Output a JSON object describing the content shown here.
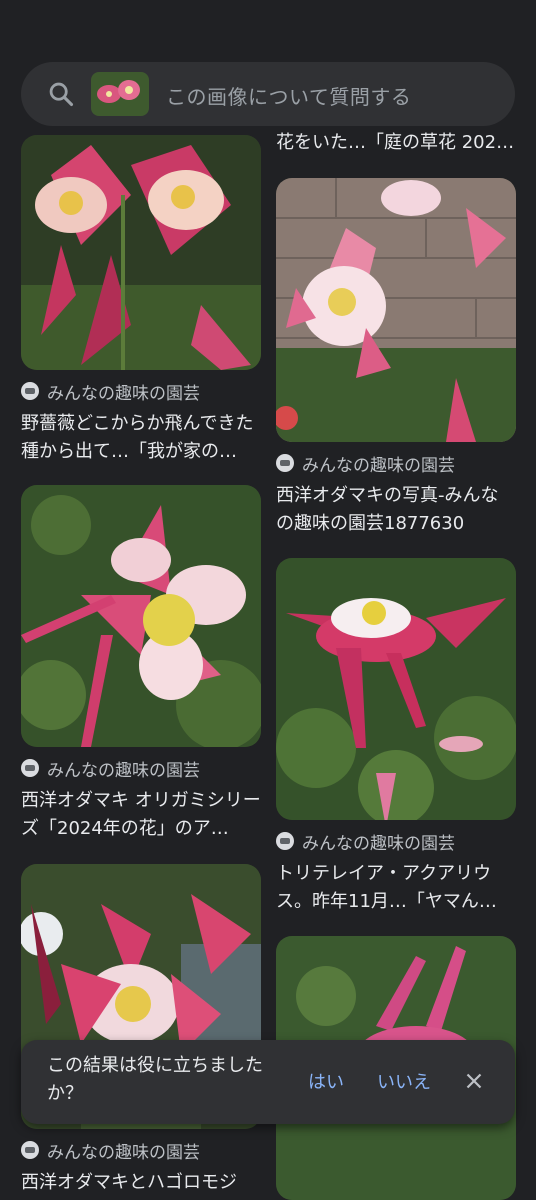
{
  "search": {
    "placeholder": "この画像について質問する"
  },
  "previous_title": "花をいた…「庭の草花 202…",
  "results": {
    "left": [
      {
        "source": "みんなの趣味の園芸",
        "title": "野薔薇どこからか飛んできた種から出て…「我が家の…"
      },
      {
        "source": "みんなの趣味の園芸",
        "title": "西洋オダマキ オリガミシリーズ「2024年の花」のア…"
      },
      {
        "source": "みんなの趣味の園芸",
        "title": "西洋オダマキとハゴロモジ"
      }
    ],
    "right": [
      {
        "source": "みんなの趣味の園芸",
        "title": "西洋オダマキの写真-みんなの趣味の園芸1877630"
      },
      {
        "source": "みんなの趣味の園芸",
        "title": "トリテレイア・アクアリウス。昨年11月…「ヤマん…"
      }
    ]
  },
  "feedback": {
    "question": "この結果は役に立ちましたか？",
    "yes": "はい",
    "no": "いいえ"
  },
  "colors": {
    "background": "#202124",
    "surface": "#303134",
    "link": "#8ab4f8",
    "flower_pink": "#e0457a"
  }
}
